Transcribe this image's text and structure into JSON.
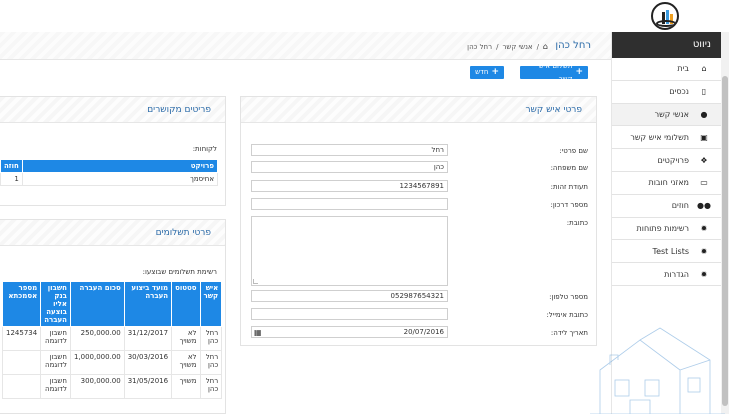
{
  "app": {
    "brand": "ניווט"
  },
  "header": {
    "page_title": "רחל כהן",
    "breadcrumb": [
      "אנשי קשר",
      "רחל כהן"
    ]
  },
  "buttons": {
    "add_payment": "תשלום איש קשר",
    "add_new": "חדש"
  },
  "sidebar": {
    "items": [
      {
        "label": "בית",
        "icon": "home-icon",
        "glyph": "⌂"
      },
      {
        "label": "נכסים",
        "icon": "mobile-icon",
        "glyph": "▯"
      },
      {
        "label": "אנשי קשר",
        "icon": "user-icon",
        "glyph": "●"
      },
      {
        "label": "תשלומי איש קשר",
        "icon": "money-icon",
        "glyph": "▣"
      },
      {
        "label": "פרויקטים",
        "icon": "cubes-icon",
        "glyph": "❖"
      },
      {
        "label": "מאזני חובות",
        "icon": "card-icon",
        "glyph": "▭"
      },
      {
        "label": "חוזים",
        "icon": "users-icon",
        "glyph": "●●"
      },
      {
        "label": "רשימות פתוחות",
        "icon": "gear-icon",
        "glyph": "✹"
      },
      {
        "label": "Test Lists",
        "icon": "gear-icon",
        "glyph": "✹"
      },
      {
        "label": "הגדרות",
        "icon": "gear-icon",
        "glyph": "✹"
      }
    ]
  },
  "contact_panel": {
    "title": "פרטי איש קשר",
    "fields": {
      "first_name": {
        "label": "שם פרטי:",
        "value": "רחל"
      },
      "last_name": {
        "label": "שם משפחה:",
        "value": "כהן"
      },
      "id_number": {
        "label": "תעודת זהות:",
        "value": "1234567891"
      },
      "passport": {
        "label": "מספר דרכון:",
        "value": ""
      },
      "address": {
        "label": "כתובת:",
        "value": ""
      },
      "phone": {
        "label": "מספר טלפון:",
        "value": "052987654321"
      },
      "email": {
        "label": "כתובת אימייל:",
        "value": ""
      },
      "birthdate": {
        "label": "תאריך לידה:",
        "value": "20/07/2016"
      }
    }
  },
  "related_panel": {
    "title": "פריטים מקושרים",
    "clients_label": "לקוחות:",
    "columns": [
      "פרויקט",
      "חוזה"
    ],
    "rows": [
      [
        "אחיסמך",
        "1"
      ]
    ]
  },
  "payments_panel": {
    "title": "פרטי תשלומים",
    "list_label": "רשימת תשלומים שבוצעו:",
    "columns": [
      "איש קשר",
      "סטטוס",
      "מועד ביצוע העברה",
      "סכום העברה",
      "חשבון בנק אליו בוצעה העברה",
      "מספר אסמכתא"
    ],
    "rows": [
      [
        "רחל כהן",
        "לא משויך",
        "31/12/2017",
        "250,000.00",
        "חשבון לדוגמה",
        "1245734"
      ],
      [
        "רחל כהן",
        "לא משויך",
        "30/03/2016",
        "1,000,000.00",
        "חשבון לדוגמה",
        ""
      ],
      [
        "רחל כהן",
        "משויך",
        "31/05/2016",
        "300,000.00",
        "חשבון לדוגמה",
        ""
      ]
    ]
  },
  "colors": {
    "accent": "#1e88e5",
    "title": "#2a6aa8",
    "sidebar_head": "#2f2f2f"
  }
}
